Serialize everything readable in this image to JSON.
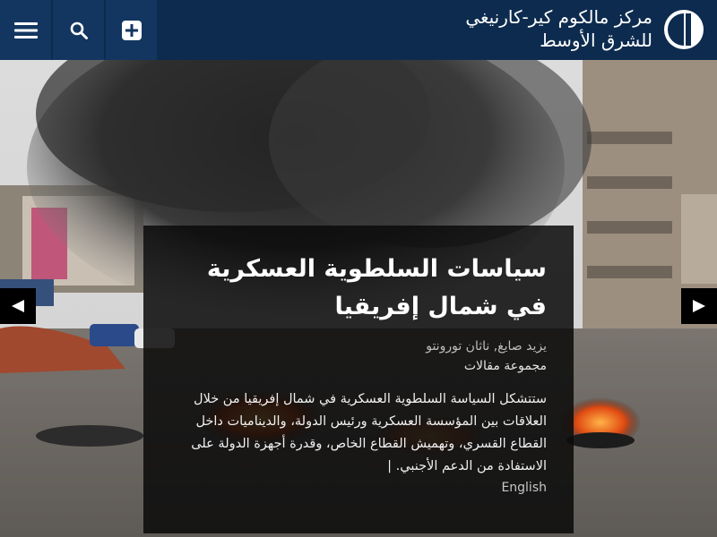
{
  "header": {
    "logo_line1": "مركز مالكوم كير-كارنيغي",
    "logo_line2": "للشرق الأوسط",
    "menu_icon": "hamburger-menu-icon",
    "search_icon": "search-icon",
    "add_icon": "plus-square-icon"
  },
  "feature": {
    "title": "سياسات السلطوية العسكرية في شمال إفريقيا",
    "authors": "يزيد صايغ, ناثان تورونتو",
    "series": "مجموعة مقالات",
    "description": "ستتشكل السياسة السلطوية العسكرية في شمال إفريقيا من خلال العلاقات بين المؤسسة العسكرية ورئيس الدولة، والديناميات داخل القطاع القسري، وتهميش القطاع الخاص، وقدرة أجهزة الدولة على الاستفادة من الدعم الأجنبي. |",
    "language_link": "English"
  },
  "carousel": {
    "prev_icon": "arrow-left-icon",
    "next_icon": "arrow-right-icon"
  },
  "colors": {
    "header_bg": "#0d2b4e",
    "header_button_bg": "#133660",
    "card_bg": "#0a0a0a"
  }
}
